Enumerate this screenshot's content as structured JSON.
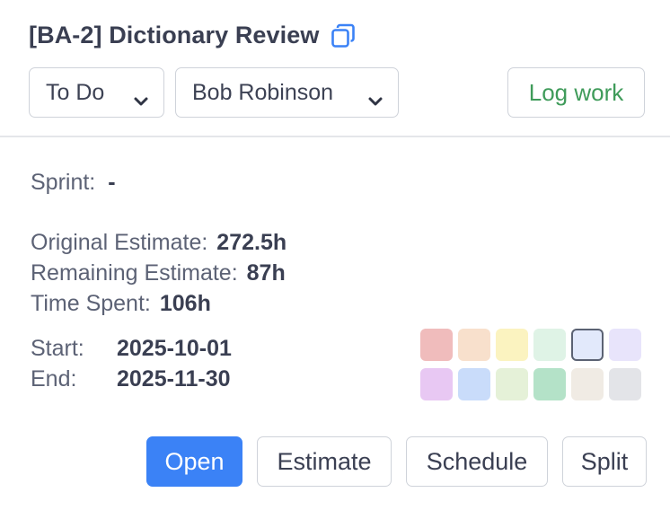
{
  "header": {
    "title": "[BA-2] Dictionary Review",
    "copy_icon": "copy-icon"
  },
  "controls": {
    "status": "To Do",
    "assignee": "Bob Robinson",
    "log_work_label": "Log work",
    "log_work_color": "#3f9b5a"
  },
  "details": {
    "sprint_label": "Sprint:",
    "sprint_value": "-",
    "original_estimate_label": "Original Estimate:",
    "original_estimate_value": "272.5h",
    "remaining_estimate_label": "Remaining Estimate:",
    "remaining_estimate_value": "87h",
    "time_spent_label": "Time Spent:",
    "time_spent_value": "106h",
    "start_label": "Start:",
    "start_value": "2025-10-01",
    "end_label": "End:",
    "end_value": "2025-11-30"
  },
  "colors": {
    "palette": [
      "#f0bcbc",
      "#f8e0cc",
      "#fbf3c0",
      "#dff3e6",
      "#e2e9fb",
      "#e8e4fb",
      "#e8c8f3",
      "#c9dcfa",
      "#e5f1d8",
      "#b4e2c8",
      "#f0ebe4",
      "#e3e4e8"
    ],
    "selected_index": 4
  },
  "actions": {
    "open_label": "Open",
    "estimate_label": "Estimate",
    "schedule_label": "Schedule",
    "split_label": "Split",
    "accent": "#3b82f6"
  }
}
